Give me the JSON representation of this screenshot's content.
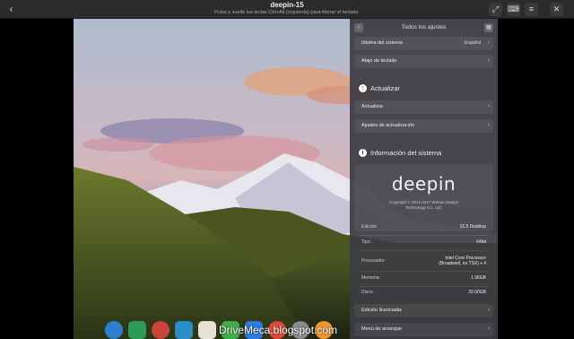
{
  "window": {
    "title": "deepin-15",
    "subtitle": "Pulse y suelte las teclas Ctrl+Alt (izquierda) para liberar el teclado.",
    "back_icon": "‹"
  },
  "settings": {
    "header_title": "Todos los ajustes",
    "rows_top": [
      {
        "label": "Idioma del sistema",
        "value": "Español"
      },
      {
        "label": "Atajo de teclado",
        "value": ""
      }
    ],
    "update_section": "Actualizar",
    "update_rows": [
      {
        "label": "Actualizar"
      },
      {
        "label": "Ajustes de actualización"
      }
    ],
    "info_section": "Información del sistema",
    "logo_text": "deepin",
    "copyright_line1": "Copyright © 2011-2017 Wuhan Deepin",
    "copyright_line2": "Technology Co., Ltd.",
    "info": [
      {
        "key": "Edición:",
        "value": "15.5 Desktop"
      },
      {
        "key": "Tipo:",
        "value": "64bit"
      },
      {
        "key": "Procesador:",
        "value": "Intel Core Processor (Broadwell, no TSX) x 4"
      },
      {
        "key": "Memoria:",
        "value": "1.96GB"
      },
      {
        "key": "Disco:",
        "value": "20.00GB"
      }
    ],
    "license_label": "Edición licenciada:",
    "boot_label": "Menú de arranque"
  },
  "dock": {
    "items": [
      {
        "name": "launcher-icon",
        "color": "#2f7fd0"
      },
      {
        "name": "desktop-icon",
        "color": "#2e9a58"
      },
      {
        "name": "browser-icon",
        "color": "#c9443a"
      },
      {
        "name": "store-icon",
        "color": "#2a8fc8"
      },
      {
        "name": "music-icon",
        "color": "#e8e1d5"
      },
      {
        "name": "terminal-icon",
        "color": "#3fae4a"
      },
      {
        "name": "calendar-icon",
        "color": "#2d7be0"
      },
      {
        "name": "chrome-icon",
        "color": "#e04a3a"
      },
      {
        "name": "settings-icon",
        "color": "#8a8a92"
      },
      {
        "name": "files-icon",
        "color": "#f0962e"
      }
    ]
  },
  "watermark": "DriveMeca.blogspot.com"
}
